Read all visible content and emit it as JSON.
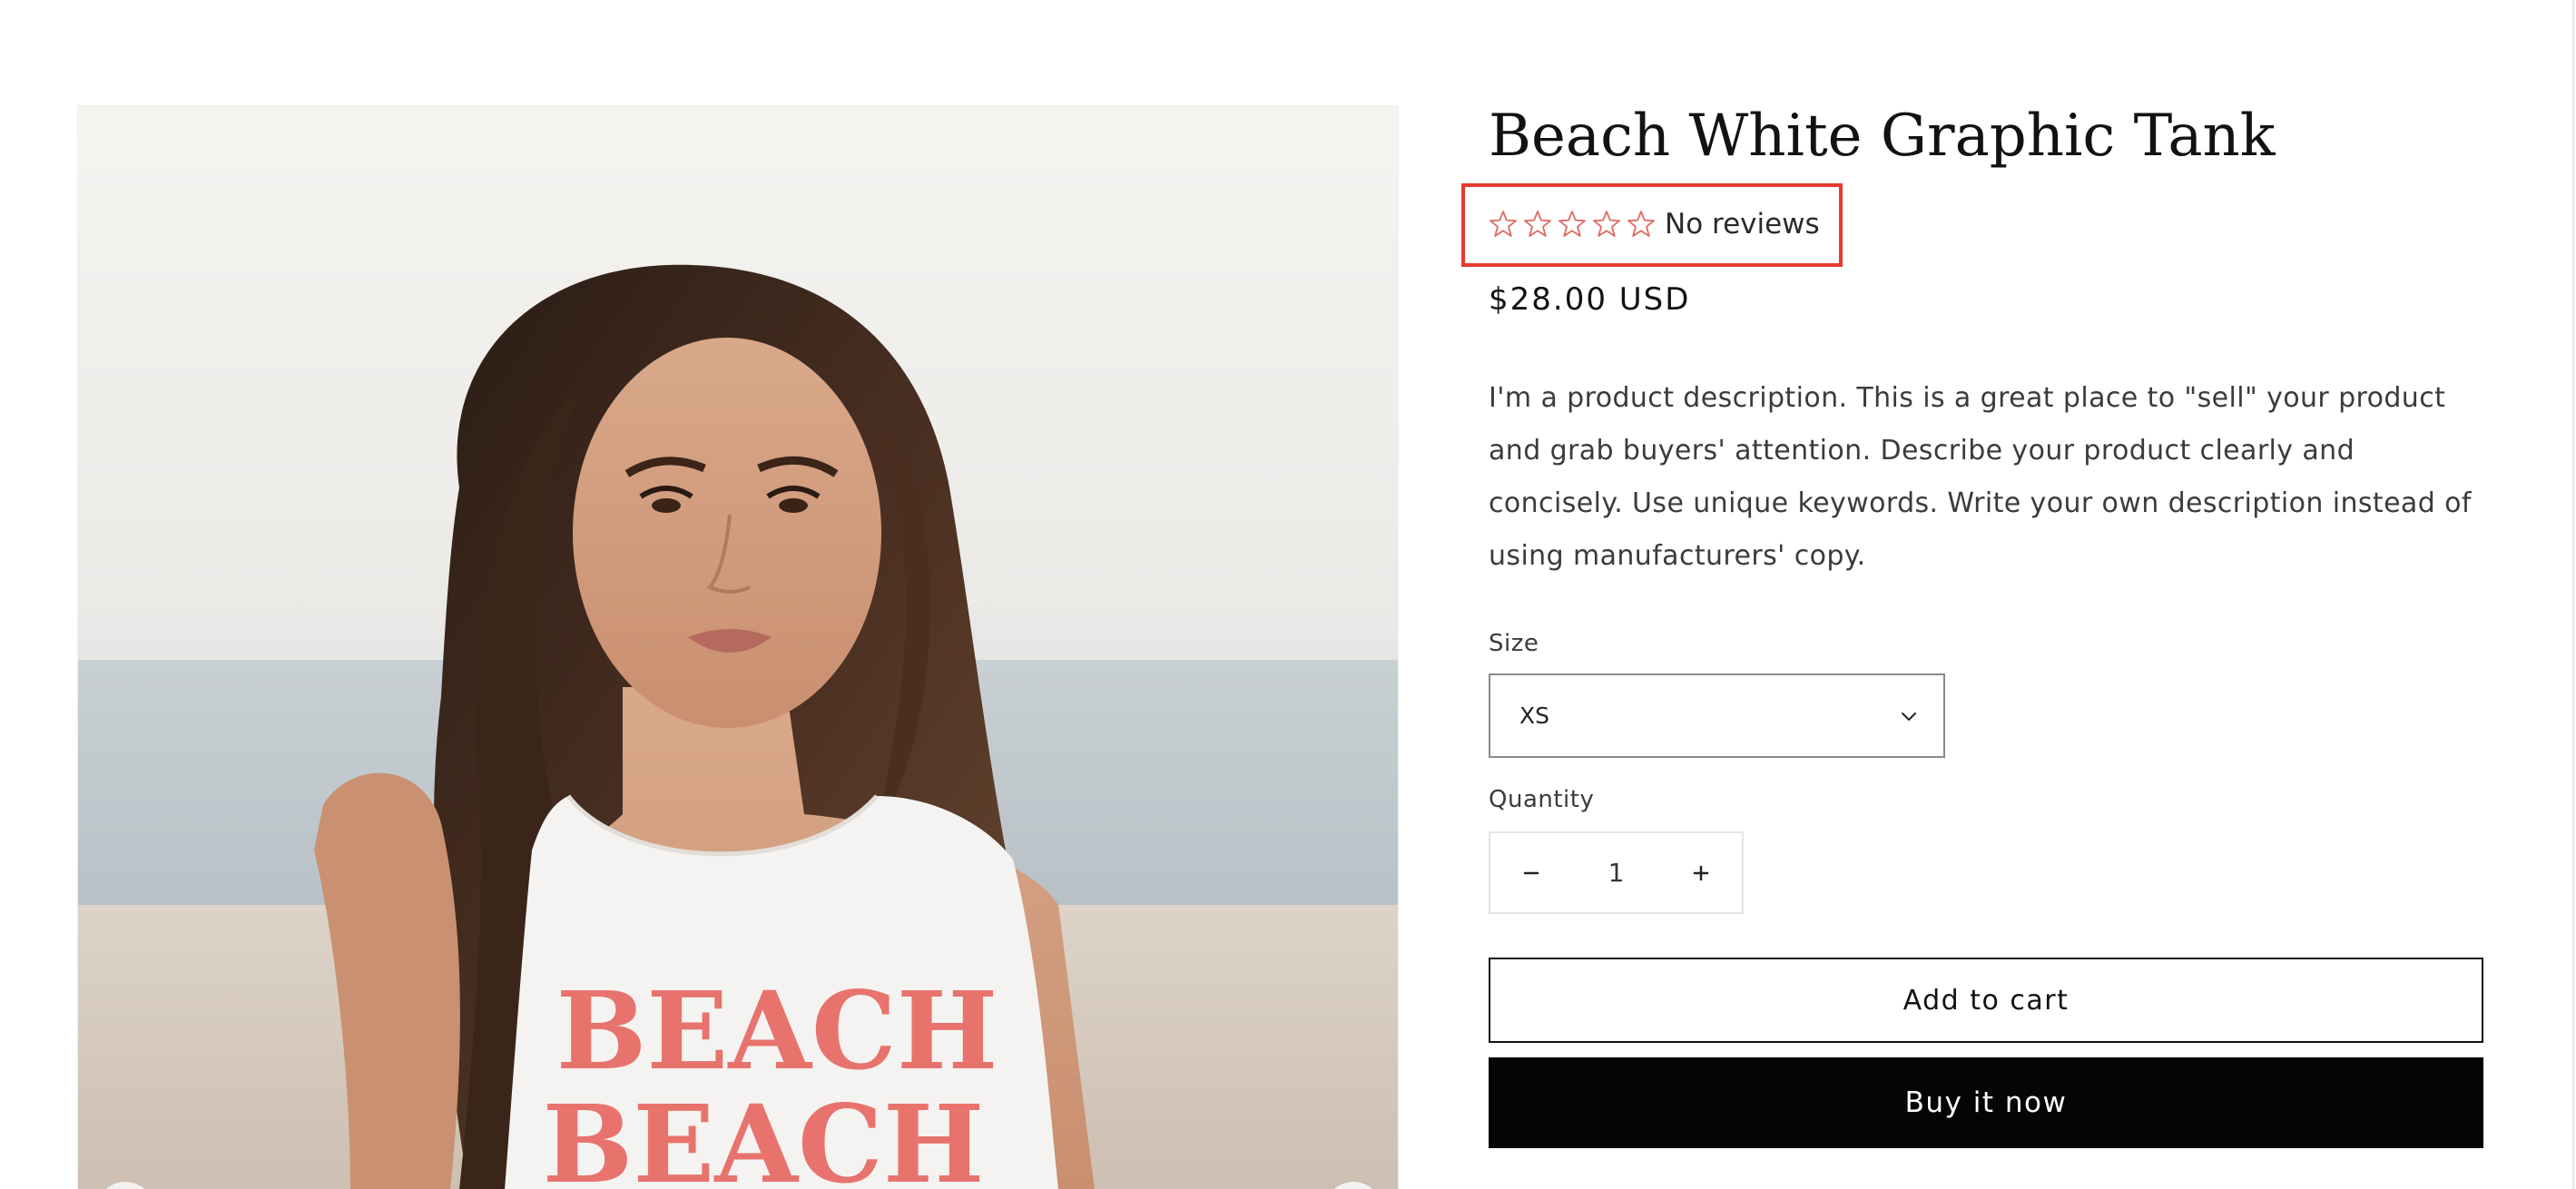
{
  "product": {
    "title": "Beach White Graphic Tank",
    "rating": {
      "stars_filled": 0,
      "stars_total": 5,
      "label": "No reviews",
      "star_color": "#e06a63",
      "highlight_color": "#e63a2e"
    },
    "price": "$28.00 USD",
    "description": "I'm a product description. This is a great place to \"sell\" your product and grab buyers' attention. Describe your product clearly and concisely. Use unique keywords. Write your own description instead of using manufacturers' copy."
  },
  "options": {
    "size_label": "Size",
    "size_value": "XS",
    "quantity_label": "Quantity",
    "quantity_value": "1"
  },
  "actions": {
    "add_to_cart": "Add to cart",
    "buy_now": "Buy it now",
    "buy_now_bg": "#050505"
  },
  "gallery": {
    "shirt_print_line1": "BEACH",
    "shirt_print_line2": "BEACH",
    "print_color": "#e8736d",
    "prev_icon": "chevron-left-icon",
    "next_icon": "chevron-right-icon"
  }
}
